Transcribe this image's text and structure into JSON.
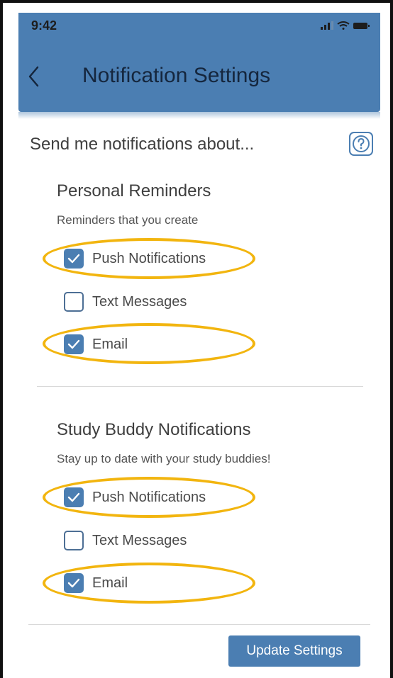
{
  "status_bar": {
    "time": "9:42"
  },
  "header": {
    "title": "Notification Settings"
  },
  "prompt": "Send me notifications about...",
  "sections": [
    {
      "title": "Personal Reminders",
      "description": "Reminders that you create",
      "options": [
        {
          "label": "Push Notifications",
          "checked": true,
          "highlighted": true
        },
        {
          "label": "Text Messages",
          "checked": false,
          "highlighted": false
        },
        {
          "label": "Email",
          "checked": true,
          "highlighted": true
        }
      ]
    },
    {
      "title": "Study Buddy Notifications",
      "description": "Stay up to date with your study buddies!",
      "options": [
        {
          "label": "Push Notifications",
          "checked": true,
          "highlighted": true
        },
        {
          "label": "Text Messages",
          "checked": false,
          "highlighted": false
        },
        {
          "label": "Email",
          "checked": true,
          "highlighted": true
        }
      ]
    }
  ],
  "update_button": "Update Settings",
  "colors": {
    "header": "#4b7eb2",
    "checkbox": "#4b7eb2",
    "highlight": "#f2b50f",
    "button": "#4b7eb2"
  }
}
